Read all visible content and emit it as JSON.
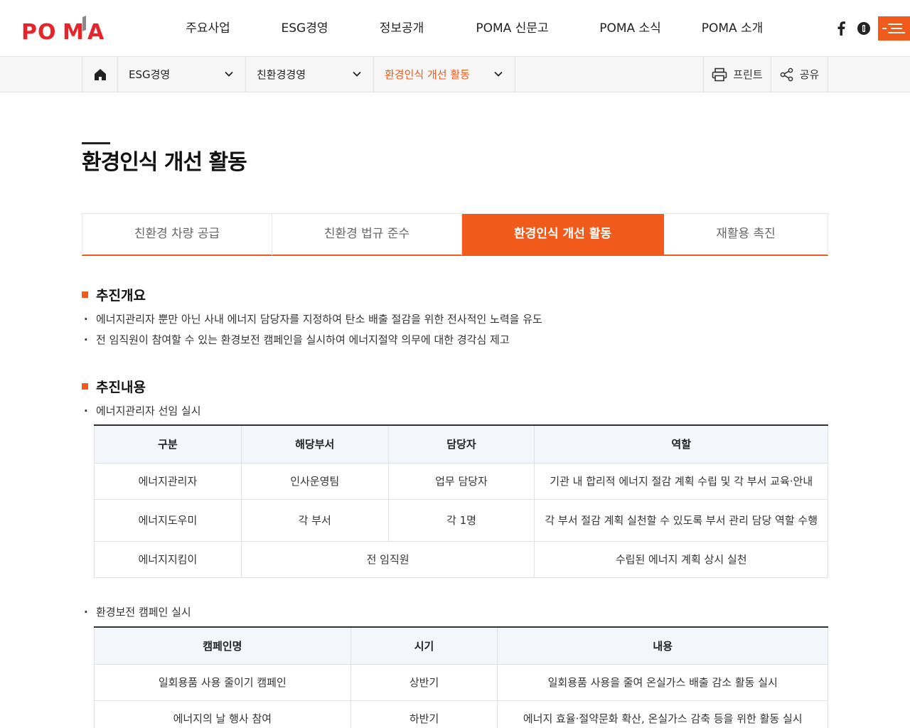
{
  "header": {
    "logo_text": "POMA",
    "gnb": [
      "주요사업",
      "ESG경영",
      "정보공개",
      "POMA 신문고",
      "POMA 소식",
      "POMA 소개"
    ]
  },
  "location": {
    "depth1": "ESG경영",
    "depth2": "친환경경영",
    "depth3": "환경인식 개선 활동",
    "print": "프린트",
    "share": "공유"
  },
  "page": {
    "title": "환경인식 개선 활동"
  },
  "tabs": [
    "친환경 차량 공급",
    "친환경 법규 준수",
    "환경인식 개선 활동",
    "재활용 촉진"
  ],
  "overview": {
    "heading": "추진개요",
    "items": [
      "에너지관리자 뿐만 아닌 사내 에너지 담당자를 지정하여 탄소 배출 절감을 위한 전사적인 노력을 유도",
      "전 임직원이 참여할 수 있는 환경보전 캠페인을 실시하여 에너지절약 의무에 대한 경각심 제고"
    ]
  },
  "content": {
    "heading": "추진내용",
    "sub1": "에너지관리자 선임 실시",
    "table1": {
      "headers": [
        "구분",
        "해당부서",
        "담당자",
        "역할"
      ],
      "rows": [
        [
          "에너지관리자",
          "인사운영팀",
          "업무 담당자",
          "기관 내 합리적 에너지 절감 계획 수립 및 각 부서 교육·안내"
        ],
        [
          "에너지도우미",
          "각 부서",
          "각 1명",
          "각 부서 절감 계획 실천할 수 있도록 부서 관리 담당 역할 수행"
        ],
        [
          "에너지지킴이",
          "전 임직원",
          "수립된 에너지 계획 상시 실천"
        ]
      ]
    },
    "sub2": "환경보전 캠페인 실시",
    "table2": {
      "headers": [
        "캠페인명",
        "시기",
        "내용"
      ],
      "rows": [
        [
          "일회용품 사용 줄이기 캠페인",
          "상반기",
          "일회용품 사용을 줄여 온실가스 배출 감소 활동 실시"
        ],
        [
          "에너지의 날 행사 참여",
          "하반기",
          "에너지 효율·절약문화 확산, 온실가스 감축 등을 위한 활동 실시"
        ]
      ]
    }
  },
  "colors": {
    "accent": "#f05a1a",
    "logo_red": "#e8242b",
    "logo_grey": "#8a8a8a"
  }
}
